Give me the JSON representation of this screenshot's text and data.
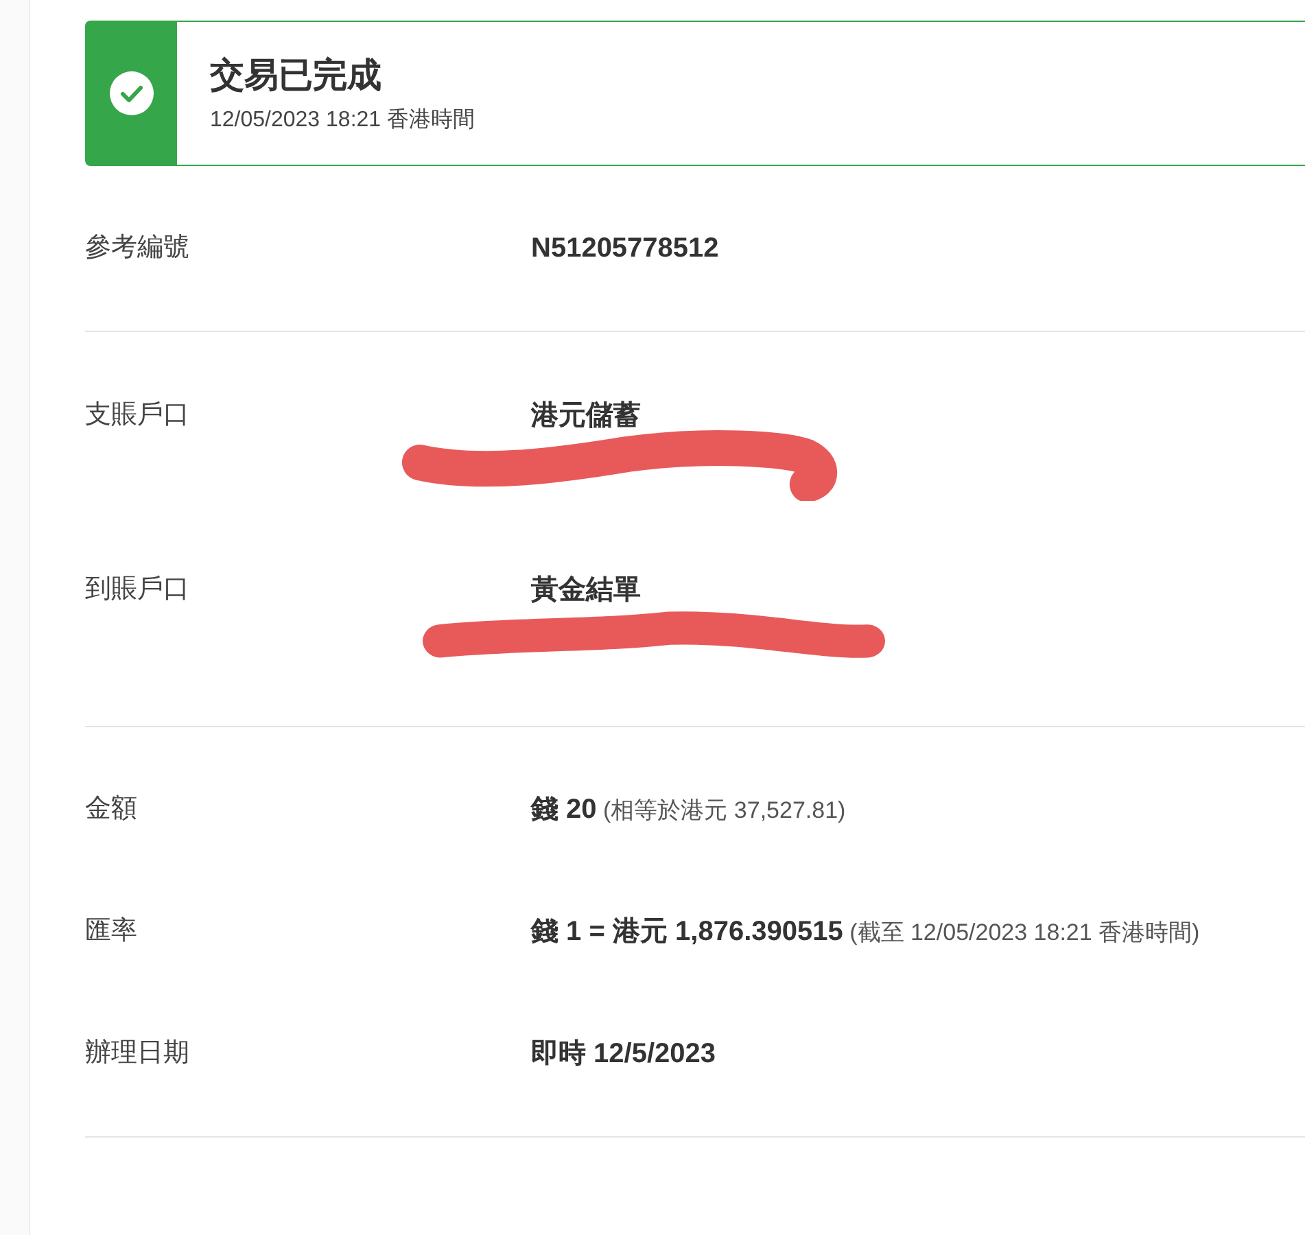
{
  "banner": {
    "title": "交易已完成",
    "timestamp": "12/05/2023 18:21 香港時間"
  },
  "sections": [
    {
      "rows": [
        {
          "label": "參考編號",
          "value": "N51205778512",
          "redacted": false
        }
      ]
    },
    {
      "rows": [
        {
          "label": "支賬戶口",
          "value": "**港元儲蓄**",
          "redacted": true
        },
        {
          "label": "到賬戶口",
          "value": "**黃金結單**",
          "redacted": true
        }
      ]
    },
    {
      "rows": [
        {
          "label": "金額",
          "value": "**錢 20** (相等於港元 37,527.81)",
          "redacted": false
        },
        {
          "label": "匯率",
          "value": "**錢 1 = 港元 1,876.390515** (截至 12/05/2023 18:21 香港時間)",
          "redacted": false
        },
        {
          "label": "辦理日期",
          "value": "**即時 12/5/2023**",
          "redacted": false
        }
      ]
    }
  ]
}
